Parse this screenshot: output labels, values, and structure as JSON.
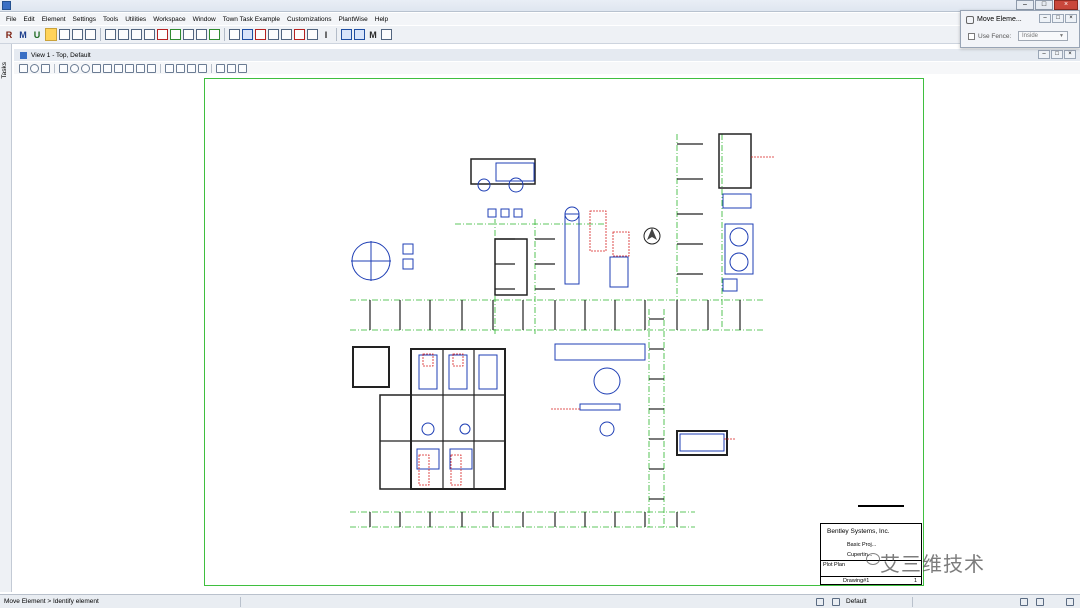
{
  "window": {
    "title": ""
  },
  "menubar": {
    "items": [
      "File",
      "Edit",
      "Element",
      "Settings",
      "Tools",
      "Utilities",
      "Workspace",
      "Window",
      "Town Task Example",
      "Customizations",
      "PlantWise",
      "Help"
    ]
  },
  "toolbar": {
    "letters": [
      "R",
      "M",
      "U",
      "M",
      "I"
    ]
  },
  "tasks": {
    "label": "Tasks"
  },
  "view": {
    "title": "View 1 - Top, Default"
  },
  "dialog": {
    "title": "Move Eleme...",
    "use_fence_label": "Use Fence:",
    "fence_mode": "Inside"
  },
  "title_block": {
    "company": "Bentley Systems, Inc.",
    "project": "Basic Proj...",
    "location": "Cupertin...",
    "plot_label": "Plot Plan",
    "drawing": "Drawing#1",
    "sheet_no": "1"
  },
  "status": {
    "message": "Move Element > Identify element",
    "level": "Default"
  },
  "watermark": {
    "text": "艾三维技术"
  },
  "colors": {
    "sheet_border": "#3fbf3f",
    "equipment": "#1f3fb5",
    "grid_lines": "#2bb52b",
    "annotation": "#d62020",
    "structure": "#222222"
  }
}
